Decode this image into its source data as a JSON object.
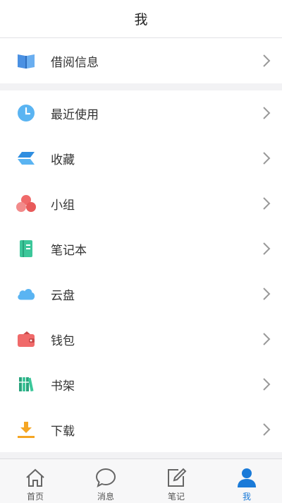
{
  "header": {
    "title": "我"
  },
  "menu_top": [
    {
      "label": "借阅信息",
      "icon": "book-icon"
    }
  ],
  "menu_main": [
    {
      "label": "最近使用",
      "icon": "clock-icon"
    },
    {
      "label": "收藏",
      "icon": "bookmark-stack-icon"
    },
    {
      "label": "小组",
      "icon": "group-icon"
    },
    {
      "label": "笔记本",
      "icon": "notebook-icon"
    },
    {
      "label": "云盘",
      "icon": "cloud-icon"
    },
    {
      "label": "钱包",
      "icon": "wallet-icon"
    },
    {
      "label": "书架",
      "icon": "bookshelf-icon"
    },
    {
      "label": "下载",
      "icon": "download-icon"
    }
  ],
  "tabbar": [
    {
      "label": "首页",
      "icon": "home-icon",
      "active": false
    },
    {
      "label": "消息",
      "icon": "message-icon",
      "active": false
    },
    {
      "label": "笔记",
      "icon": "note-edit-icon",
      "active": false
    },
    {
      "label": "我",
      "icon": "user-icon",
      "active": true
    }
  ],
  "colors": {
    "accent": "#1a7ad8",
    "background": "#f2f2f4"
  }
}
